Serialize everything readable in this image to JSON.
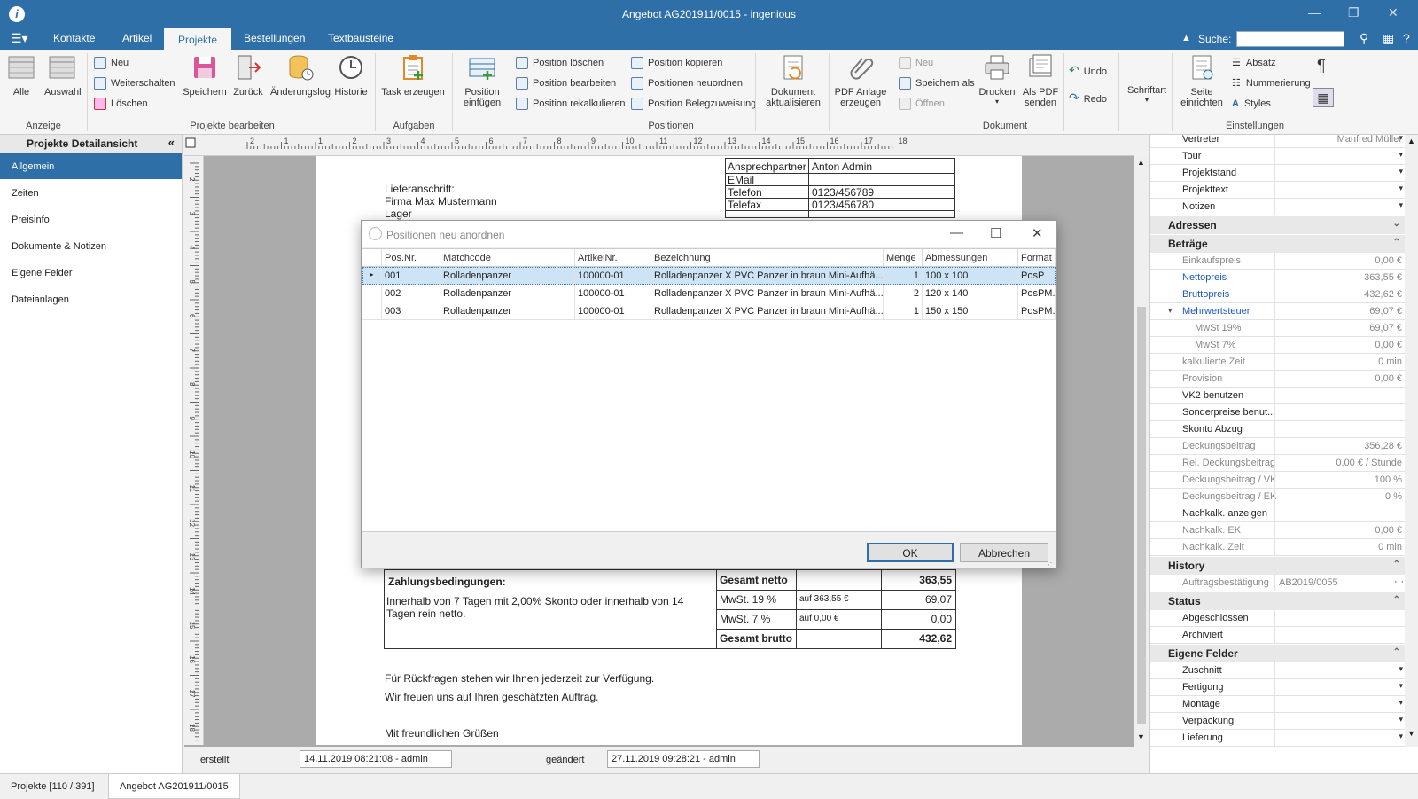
{
  "window": {
    "title": "Angebot AG201911/0015 - ingenious",
    "minimize": "—",
    "maximize": "❐",
    "close": "✕"
  },
  "menu": {
    "app_icon": "menu-list-icon",
    "tabs": [
      "Kontakte",
      "Artikel",
      "Projekte",
      "Bestellungen",
      "Textbausteine"
    ],
    "active_tab": "Projekte",
    "search_label": "Suche:",
    "help": "?"
  },
  "ribbon": {
    "groups": {
      "anzeige": "Anzeige",
      "projekte_bearbeiten": "Projekte bearbeiten",
      "aufgaben": "Aufgaben",
      "positionen": "Positionen",
      "dokument": "Dokument",
      "einstellungen": "Einstellungen"
    },
    "alle": "Alle",
    "auswahl": "Auswahl",
    "neu": "Neu",
    "weiterschalten": "Weiterschalten",
    "loeschen": "Löschen",
    "speichern": "Speichern",
    "zurueck": "Zurück",
    "aenderungslog": "Änderungslog",
    "historie": "Historie",
    "task_erzeugen": "Task erzeugen",
    "position_einfuegen_1": "Position",
    "position_einfuegen_2": "einfügen",
    "position_loeschen": "Position löschen",
    "position_bearbeiten": "Position bearbeiten",
    "position_rekalkulieren": "Position rekalkulieren",
    "position_kopieren": "Position kopieren",
    "positionen_neuordnen": "Positionen neuordnen",
    "position_belegzuweisung": "Position Belegzuweisung",
    "dokument_aktualisieren_1": "Dokument",
    "dokument_aktualisieren_2": "aktualisieren",
    "pdf_anlage_1": "PDF Anlage",
    "pdf_anlage_2": "erzeugen",
    "doc_neu": "Neu",
    "speichern_als": "Speichern als",
    "oeffnen": "Öffnen",
    "drucken": "Drucken",
    "als_pdf_1": "Als PDF",
    "als_pdf_2": "senden",
    "undo": "Undo",
    "redo": "Redo",
    "schriftart": "Schriftart",
    "seite_einrichten_1": "Seite",
    "seite_einrichten_2": "einrichten",
    "absatz": "Absatz",
    "nummerierung": "Nummerierung",
    "styles": "Styles",
    "pilcrow": "¶"
  },
  "left_panel": {
    "title": "Projekte Detailansicht",
    "collapse": "«",
    "items": [
      "Allgemein",
      "Zeiten",
      "Preisinfo",
      "Dokumente & Notizen",
      "Eigene Felder",
      "Dateianlagen"
    ],
    "active": "Allgemein"
  },
  "ruler_numbers": [
    "2",
    "1",
    "1",
    "2",
    "3",
    "4",
    "5",
    "6",
    "7",
    "8",
    "9",
    "10",
    "11",
    "12",
    "13",
    "14",
    "15",
    "16",
    "17",
    "18"
  ],
  "ruler_left_numbers": [
    "2",
    "3",
    "4",
    "5",
    "6",
    "7",
    "8",
    "9",
    "10",
    "11",
    "12",
    "13",
    "14",
    "15",
    "16",
    "17",
    "18"
  ],
  "document": {
    "contact_table": [
      {
        "k": "Ansprechpartner",
        "v": "Anton Admin"
      },
      {
        "k": "EMail",
        "v": ""
      },
      {
        "k": "Telefon",
        "v": "0123/456789"
      },
      {
        "k": "Telefax",
        "v": "0123/456780"
      }
    ],
    "lieferanschrift": "Lieferanschrift:",
    "firma": "Firma Max Mustermann",
    "lager": "Lager",
    "zahlungsbedingungen_title": "Zahlungsbedingungen:",
    "zahlungsbedingungen_text1": "Innerhalb von 7 Tagen mit 2,00% Skonto oder innerhalb von 14",
    "zahlungsbedingungen_text2": "Tagen rein netto.",
    "totals": [
      {
        "label": "Gesamt netto",
        "basis": "",
        "value": "363,55",
        "bold": true
      },
      {
        "label": "MwSt. 19 %",
        "basis": "auf 363,55 €",
        "value": "69,07",
        "bold": false
      },
      {
        "label": "MwSt. 7 %",
        "basis": "auf 0,00 €",
        "value": "0,00",
        "bold": false
      },
      {
        "label": "Gesamt brutto",
        "basis": "",
        "value": "432,62",
        "bold": true
      }
    ],
    "rueckfragen": "Für Rückfragen stehen wir Ihnen jederzeit zur Verfügung.",
    "freuen": "Wir freuen uns auf Ihren geschätzten Auftrag.",
    "gruesse": "Mit freundlichen Grüßen"
  },
  "dialog": {
    "title": "Positionen neu anordnen",
    "columns": [
      "Pos.Nr.",
      "Matchcode",
      "ArtikelNr.",
      "Bezeichnung",
      "Menge",
      "Abmessungen",
      "Format"
    ],
    "rows": [
      {
        "pos": "001",
        "match": "Rolladenpanzer",
        "art": "100000-01",
        "bez": "Rolladenpanzer  X PVC Panzer in braun   Mini-Aufhä...",
        "menge": "1",
        "abm": "100 x 100",
        "fmt": "PosP"
      },
      {
        "pos": "002",
        "match": "Rolladenpanzer",
        "art": "100000-01",
        "bez": "Rolladenpanzer  X PVC Panzer in braun   Mini-Aufhä...",
        "menge": "2",
        "abm": "120 x 140",
        "fmt": "PosPM..."
      },
      {
        "pos": "003",
        "match": "Rolladenpanzer",
        "art": "100000-01",
        "bez": "Rolladenpanzer  X PVC Panzer in braun   Mini-Aufhä...",
        "menge": "1",
        "abm": "150 x 150",
        "fmt": "PosPM..."
      }
    ],
    "selected_row": 0,
    "ok": "OK",
    "abbrechen": "Abbrechen"
  },
  "right_panel": {
    "top_rows": [
      {
        "k": "Vertreter",
        "v": "Manfred Müller",
        "dd": true
      },
      {
        "k": "Tour",
        "v": "",
        "dd": true
      },
      {
        "k": "Projektstand",
        "v": "",
        "dd": true
      },
      {
        "k": "Projekttext",
        "v": "",
        "dd": true
      },
      {
        "k": "Notizen",
        "v": "",
        "dd": true
      }
    ],
    "adressen": "Adressen",
    "betraege": "Beträge",
    "betraege_rows": [
      {
        "k": "Einkaufspreis",
        "v": "0,00 €",
        "type": "text",
        "color": "#888888"
      },
      {
        "k": "Nettopreis",
        "v": "363,55 €",
        "type": "text",
        "color": "#1a56c4"
      },
      {
        "k": "Bruttopreis",
        "v": "432,62 €",
        "type": "text",
        "color": "#1a56c4"
      },
      {
        "k": "Mehrwertsteuer",
        "v": "69,07 €",
        "type": "text",
        "color": "#1a56c4",
        "expand": "▾"
      },
      {
        "k": "MwSt 19%",
        "v": "69,07 €",
        "type": "text",
        "color": "#888888",
        "indent": true
      },
      {
        "k": "MwSt 7%",
        "v": "0,00 €",
        "type": "text",
        "color": "#888888",
        "indent": true
      },
      {
        "k": "kalkulierte Zeit",
        "v": "0 min",
        "type": "text",
        "color": "#888888"
      },
      {
        "k": "Provision",
        "v": "0,00 €",
        "type": "text",
        "color": "#888888"
      },
      {
        "k": "VK2 benutzen",
        "v": "",
        "type": "check",
        "checked": false,
        "color": "#222222"
      },
      {
        "k": "Sonderpreise benut...",
        "v": "",
        "type": "check",
        "checked": true,
        "color": "#222222"
      },
      {
        "k": "Skonto Abzug",
        "v": "",
        "type": "check",
        "checked": true,
        "color": "#222222"
      },
      {
        "k": "Deckungsbeitrag",
        "v": "356,28 €",
        "type": "text",
        "color": "#888888"
      },
      {
        "k": "Rel. Deckungsbeitrag",
        "v": "0,00 € / Stunde",
        "type": "text",
        "color": "#888888"
      },
      {
        "k": "Deckungsbeitrag / VK",
        "v": "100 %",
        "type": "text",
        "color": "#888888"
      },
      {
        "k": "Deckungsbeitrag / EK",
        "v": "0 %",
        "type": "text",
        "color": "#888888"
      },
      {
        "k": "Nachkalk. anzeigen",
        "v": "",
        "type": "check",
        "checked": false,
        "color": "#222222"
      },
      {
        "k": "Nachkalk. EK",
        "v": "0,00 €",
        "type": "text",
        "color": "#888888"
      },
      {
        "k": "Nachkalk. Zeit",
        "v": "0 min",
        "type": "text",
        "color": "#888888"
      }
    ],
    "history": "History",
    "history_rows": [
      {
        "k": "Auftragsbestätigung",
        "v": "AB2019/0055",
        "more": "···"
      }
    ],
    "status": "Status",
    "status_rows": [
      {
        "k": "Abgeschlossen",
        "checked": false
      },
      {
        "k": "Archiviert",
        "checked": false
      }
    ],
    "eigene_felder": "Eigene Felder",
    "eigene_rows": [
      "Zuschnitt",
      "Fertigung",
      "Montage",
      "Verpackung",
      "Lieferung"
    ]
  },
  "bottom": {
    "erstellt_label": "erstellt",
    "erstellt_value": "14.11.2019 08:21:08 - admin",
    "geaendert_label": "geändert",
    "geaendert_value": "27.11.2019 09:28:21 - admin"
  },
  "tabs_bottom": [
    "Projekte [110 / 391]",
    "Angebot AG201911/0015"
  ],
  "colors": {
    "accent": "#2f6fa7",
    "selection": "#cde4f7",
    "link": "#1a56c4"
  }
}
